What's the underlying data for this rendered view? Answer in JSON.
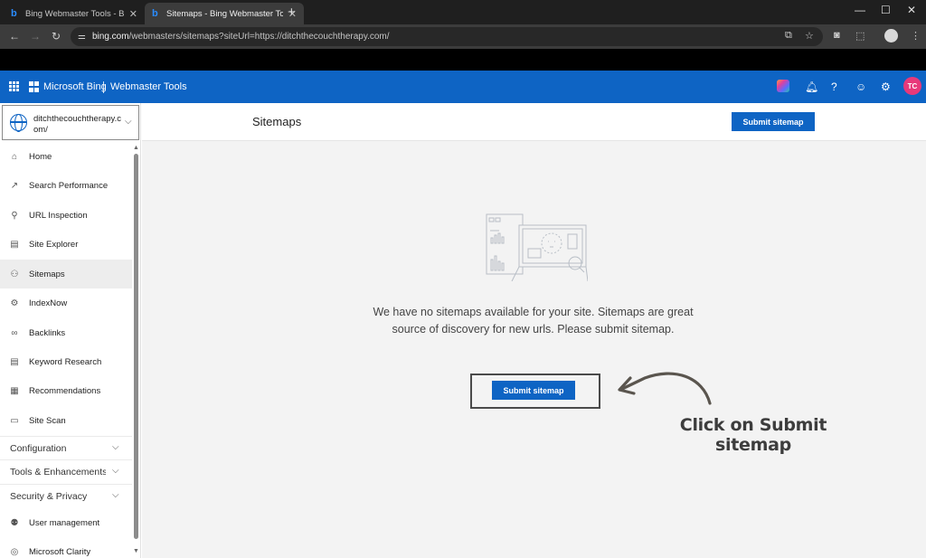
{
  "browser": {
    "tabs": [
      {
        "title": "Bing Webmaster Tools - Bing W",
        "close": "✕"
      },
      {
        "title": "Sitemaps - Bing Webmaster To",
        "close": "✕"
      }
    ],
    "new_tab": "+",
    "window_controls": {
      "minimize": "—",
      "maximize": "☐",
      "close": "✕"
    },
    "nav": {
      "back": "←",
      "forward": "→",
      "reload": "↻"
    },
    "url_domain": "bing.com",
    "url_path": "/webmasters/sitemaps?siteUrl=https://ditchthecouchtherapy.com/"
  },
  "header": {
    "brand": "Microsoft Bing",
    "product": "Webmaster Tools",
    "avatar_initials": "TC"
  },
  "site_selector": {
    "value": "ditchthecouchtherapy.com/"
  },
  "sidebar": {
    "items": [
      {
        "label": "Home",
        "icon": "home-icon",
        "glyph": "⌂"
      },
      {
        "label": "Search Performance",
        "icon": "trend-icon",
        "glyph": "↗"
      },
      {
        "label": "URL Inspection",
        "icon": "search-icon",
        "glyph": "⚲"
      },
      {
        "label": "Site Explorer",
        "icon": "document-icon",
        "glyph": "▤"
      },
      {
        "label": "Sitemaps",
        "icon": "sitemap-icon",
        "glyph": "⚇"
      },
      {
        "label": "IndexNow",
        "icon": "gear-icon",
        "glyph": "⚙"
      },
      {
        "label": "Backlinks",
        "icon": "link-icon",
        "glyph": "∞"
      },
      {
        "label": "Keyword Research",
        "icon": "document-icon",
        "glyph": "▤"
      },
      {
        "label": "Recommendations",
        "icon": "clipboard-icon",
        "glyph": "▦"
      },
      {
        "label": "Site Scan",
        "icon": "scan-icon",
        "glyph": "▭"
      }
    ],
    "groups": [
      {
        "label": "Configuration"
      },
      {
        "label": "Tools & Enhancements"
      },
      {
        "label": "Security & Privacy"
      }
    ],
    "bottom_items": [
      {
        "label": "User management",
        "icon": "user-icon",
        "glyph": "⚉"
      },
      {
        "label": "Microsoft Clarity",
        "icon": "clarity-icon",
        "glyph": "◎"
      }
    ]
  },
  "main": {
    "title": "Sitemaps",
    "submit_button": "Submit sitemap",
    "empty_message": "We have no sitemaps available for your site. Sitemaps are great source of discovery for new urls. Please submit sitemap.",
    "center_button": "Submit sitemap"
  },
  "annotation": {
    "line1": "Click on Submit",
    "line2": "sitemap"
  }
}
